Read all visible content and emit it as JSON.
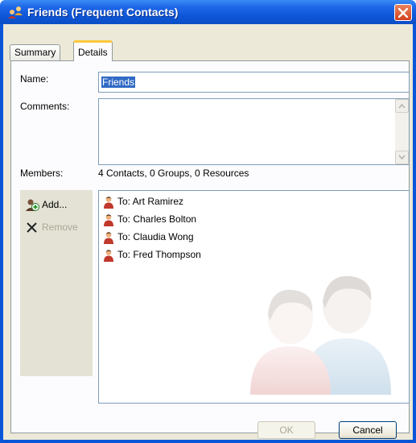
{
  "window": {
    "title": "Friends (Frequent Contacts)",
    "title_icon": "contact-group-icon",
    "close_icon": "close-icon",
    "accent": "#0b4fc4"
  },
  "tabs": [
    {
      "label": "Summary",
      "selected": false
    },
    {
      "label": "Details",
      "selected": true
    }
  ],
  "form": {
    "name_label": "Name:",
    "name_value": "Friends",
    "comments_label": "Comments:",
    "comments_value": "",
    "members_label": "Members:",
    "members_count": "4 Contacts, 0 Groups, 0 Resources"
  },
  "actions": [
    {
      "label": "Add...",
      "icon": "add-contact-icon",
      "enabled": true
    },
    {
      "label": "Remove",
      "icon": "remove-x-icon",
      "enabled": false
    }
  ],
  "members": [
    {
      "label": "To: Art Ramirez"
    },
    {
      "label": "To: Charles Bolton"
    },
    {
      "label": "To: Claudia Wong"
    },
    {
      "label": "To: Fred Thompson"
    }
  ],
  "buttons": {
    "ok_label": "OK",
    "ok_enabled": false,
    "cancel_label": "Cancel"
  }
}
